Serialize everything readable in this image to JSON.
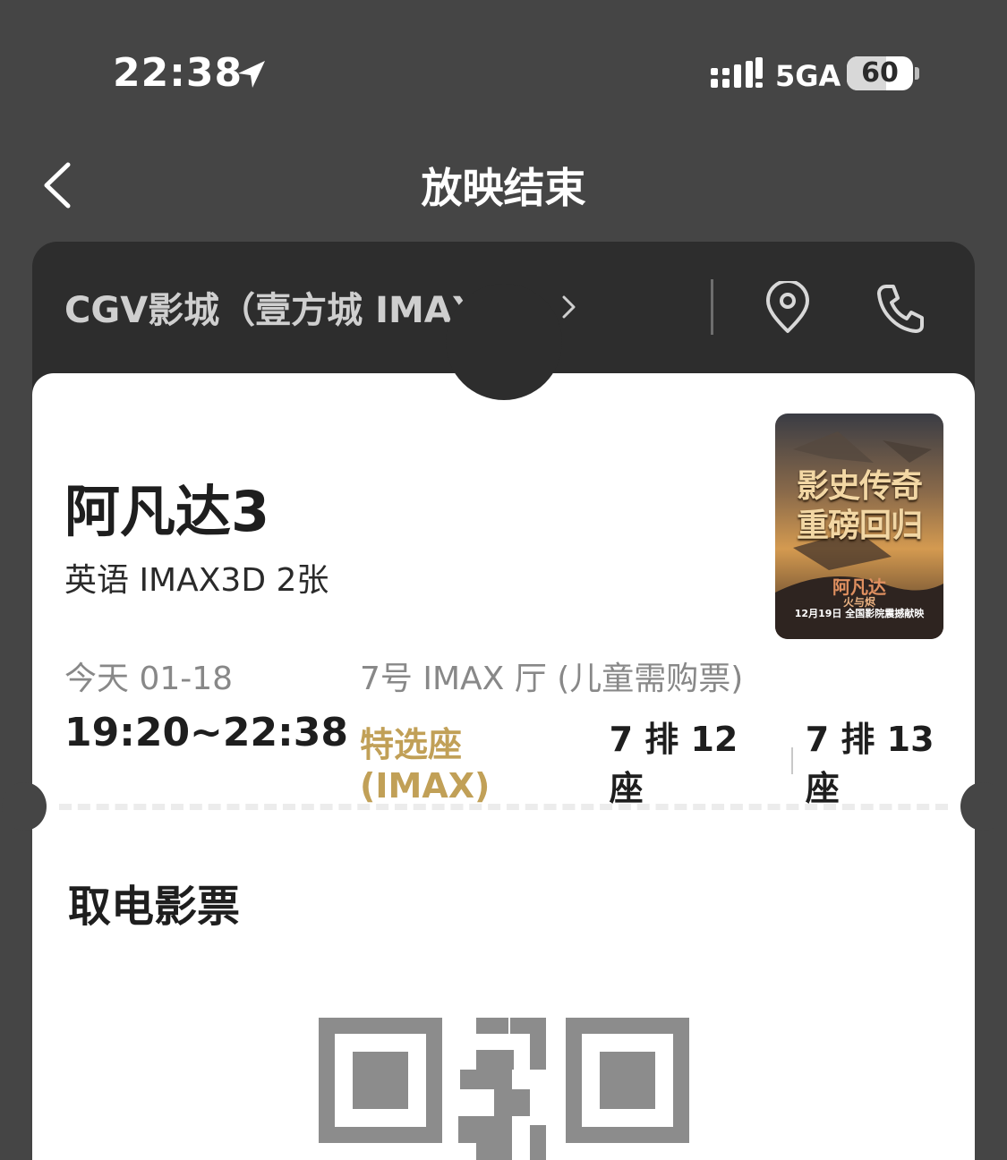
{
  "status_bar": {
    "time": "22:38",
    "network": "5GA",
    "battery_level": "60",
    "battery_fraction": 0.6
  },
  "nav": {
    "title": "放映结束"
  },
  "cinema": {
    "name": "CGV影城（壹方城 IMAX店）"
  },
  "movie": {
    "title": "阿凡达3",
    "format": "英语 IMAX3D 2张",
    "poster": {
      "slogan_line1": "影史传奇",
      "slogan_line2": "重磅回归",
      "name": "阿凡达",
      "subtitle": "火与烬",
      "date": "12月19日 全国影院震撼献映"
    }
  },
  "showing": {
    "date": "今天 01-18",
    "time": "19:20~22:38",
    "hall": "7号 IMAX 厅 (儿童需购票)",
    "seat_type": "特选座 (IMAX)",
    "seats": [
      "7 排 12 座",
      "7 排 13 座"
    ]
  },
  "pickup": {
    "label": "取电影票"
  },
  "colors": {
    "background": "#454545",
    "header": "#2d2d2d",
    "accent_gold": "#c1a057"
  }
}
